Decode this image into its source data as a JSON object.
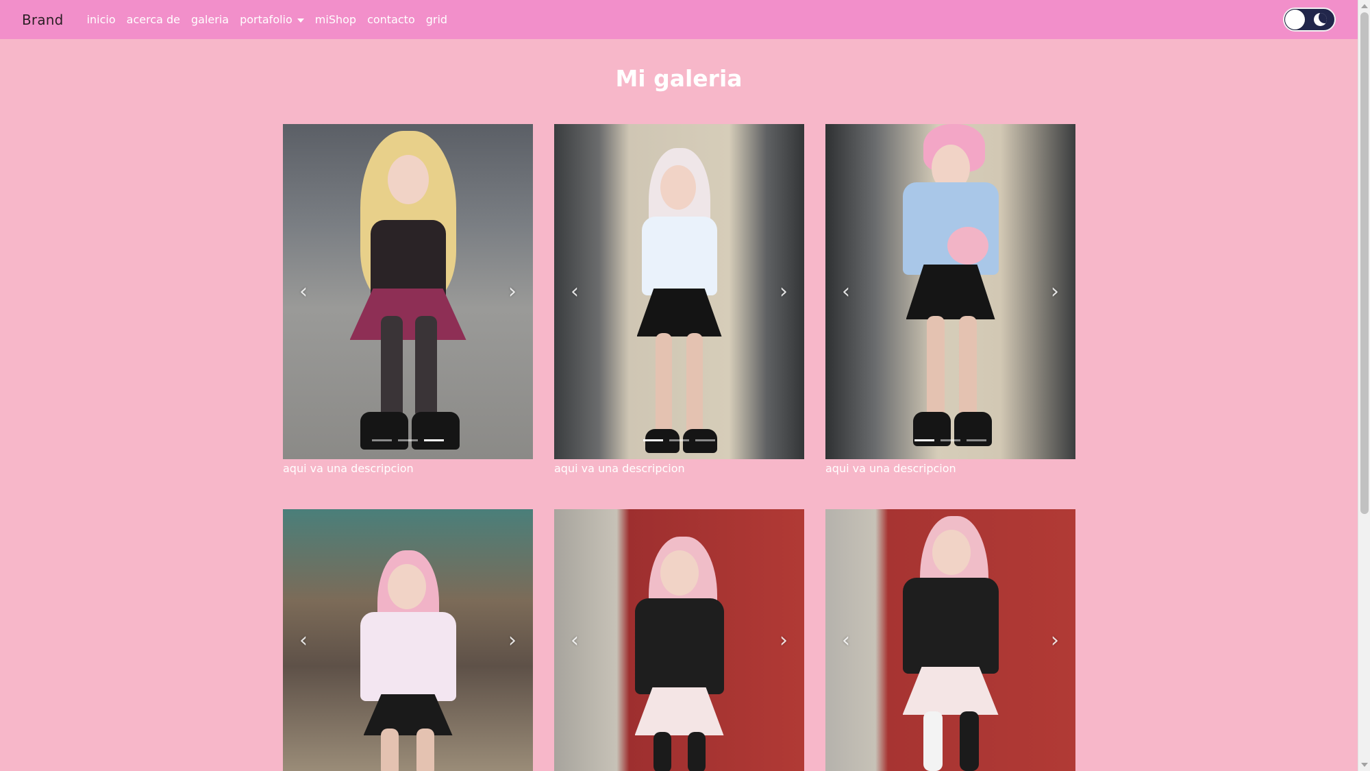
{
  "navbar": {
    "brand": "Brand",
    "links": [
      {
        "label": "inicio"
      },
      {
        "label": "acerca de"
      },
      {
        "label": "galeria"
      },
      {
        "label": "portafolio",
        "dropdown": true
      },
      {
        "label": "miShop"
      },
      {
        "label": "contacto"
      },
      {
        "label": "grid"
      }
    ],
    "theme_toggle": {
      "icon": "moon-icon",
      "state": "dark"
    }
  },
  "page": {
    "title": "Mi galeria"
  },
  "gallery": {
    "controls": {
      "prev_glyph": "‹",
      "next_glyph": "›"
    },
    "cards": [
      {
        "caption": "aqui va una descripcion",
        "active_indicator": 3,
        "indicators": 3
      },
      {
        "caption": "aqui va una descripcion",
        "active_indicator": 1,
        "indicators": 3
      },
      {
        "caption": "aqui va una descripcion",
        "active_indicator": 1,
        "indicators": 3
      },
      {
        "caption": ""
      },
      {
        "caption": ""
      },
      {
        "caption": ""
      }
    ]
  },
  "colors": {
    "background": "#f7b7c9",
    "navbar": "#f28fca",
    "toggle": "#21264b"
  }
}
